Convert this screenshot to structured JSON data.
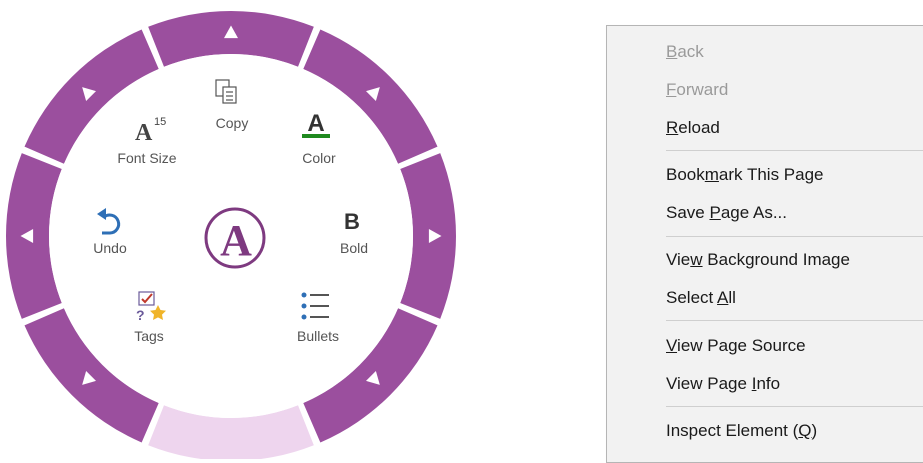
{
  "radial_menu": {
    "center_label": "A",
    "items": {
      "copy": {
        "label": "Copy"
      },
      "font_size": {
        "label": "Font Size",
        "glyph": "A",
        "badge": "15"
      },
      "color": {
        "label": "Color",
        "glyph": "A",
        "underline_color": "#1f8a1f"
      },
      "undo": {
        "label": "Undo"
      },
      "bold": {
        "label": "Bold",
        "glyph": "B"
      },
      "tags": {
        "label": "Tags"
      },
      "bullets": {
        "label": "Bullets"
      }
    },
    "colors": {
      "ring": "#9b4f9e",
      "ring_highlight": "#eed5ee",
      "center": "#7e3a80",
      "arrow": "#ffffff",
      "undo_icon": "#2e6fb6"
    }
  },
  "context_menu": {
    "items": [
      {
        "id": "back",
        "pre": "",
        "acc": "B",
        "post": "ack",
        "disabled": true
      },
      {
        "id": "forward",
        "pre": "",
        "acc": "F",
        "post": "orward",
        "disabled": true
      },
      {
        "id": "reload",
        "pre": "",
        "acc": "R",
        "post": "eload",
        "disabled": false
      },
      {
        "id": "bookmark",
        "pre": "Book",
        "acc": "m",
        "post": "ark This Page",
        "disabled": false
      },
      {
        "id": "save-page",
        "pre": "Save ",
        "acc": "P",
        "post": "age As...",
        "disabled": false
      },
      {
        "id": "view-bg",
        "pre": "Vie",
        "acc": "w",
        "post": " Background Image",
        "disabled": false
      },
      {
        "id": "select-all",
        "pre": "Select ",
        "acc": "A",
        "post": "ll",
        "disabled": false
      },
      {
        "id": "view-source",
        "pre": "",
        "acc": "V",
        "post": "iew Page Source",
        "disabled": false
      },
      {
        "id": "view-info",
        "pre": "View Page ",
        "acc": "I",
        "post": "nfo",
        "disabled": false
      },
      {
        "id": "inspect",
        "pre": "Inspect Element (",
        "acc": "Q",
        "post": ")",
        "disabled": false
      }
    ]
  }
}
